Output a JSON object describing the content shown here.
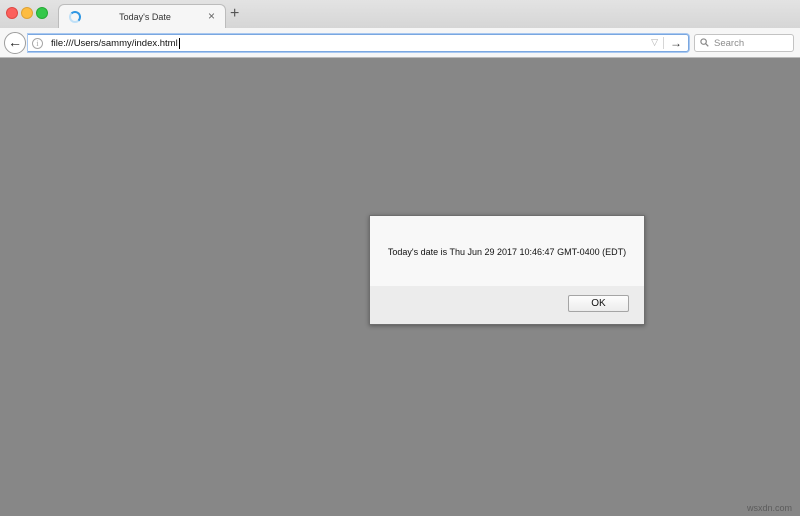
{
  "window": {
    "tab": {
      "title": "Today's Date",
      "close_glyph": "×"
    },
    "new_tab_glyph": "+"
  },
  "toolbar": {
    "back_glyph": "←",
    "info_glyph": "i",
    "url": "file:///Users/sammy/index.html",
    "dropmarker_glyph": "▽",
    "go_glyph": "→",
    "search_placeholder": "Search"
  },
  "dialog": {
    "message": "Today's date is Thu Jun 29 2017 10:46:47 GMT-0400 (EDT)",
    "ok_label": "OK"
  },
  "watermark": "wsxdn.com",
  "icons": {
    "close": "window-close-icon",
    "minimize": "window-minimize-icon",
    "maximize": "window-maximize-icon",
    "loading": "loading-spinner-icon",
    "info": "info-icon",
    "search": "search-icon"
  },
  "colors": {
    "accent": "#2d96e3",
    "close": "#fc605c",
    "minimize": "#fdbc40",
    "maximize": "#34c84a",
    "page_background": "#878787"
  }
}
